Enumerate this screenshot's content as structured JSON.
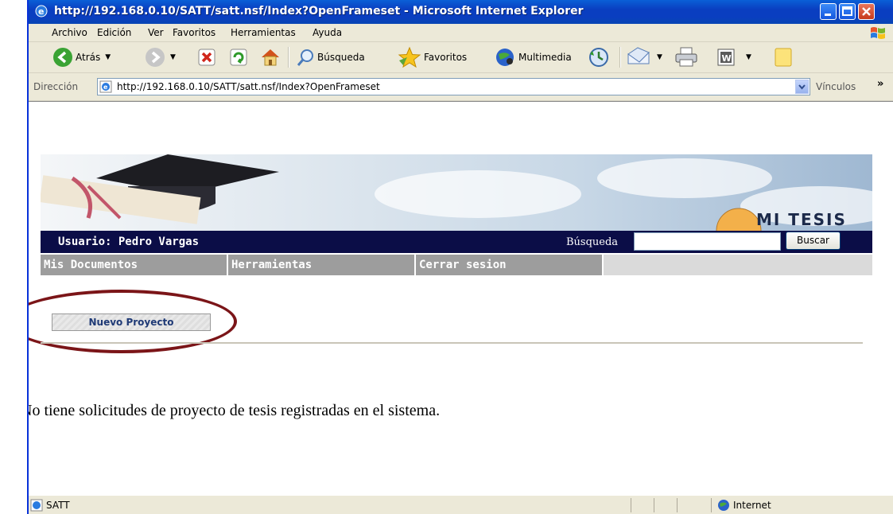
{
  "window": {
    "title": "http://192.168.0.10/SATT/satt.nsf/Index?OpenFrameset - Microsoft Internet Explorer"
  },
  "menu": [
    "Archivo",
    "Edición",
    "Ver",
    "Favoritos",
    "Herramientas",
    "Ayuda"
  ],
  "toolbar": {
    "back_label": "Atrás",
    "search_label": "Búsqueda",
    "favorites_label": "Favoritos",
    "media_label": "Multimedia"
  },
  "address": {
    "label": "Dirección",
    "url": "http://192.168.0.10/SATT/satt.nsf/Index?OpenFrameset",
    "links_label": "Vínculos"
  },
  "page": {
    "banner_title": "MI TESIS",
    "user_label": "Usuario: Pedro Vargas",
    "search_label": "Búsqueda",
    "search_value": "",
    "search_button": "Buscar",
    "nav": [
      "Mis Documentos",
      "Herramientas",
      "Cerrar sesion"
    ],
    "new_project_button": "Nuevo Proyecto",
    "message": "No tiene solicitudes de proyecto de tesis registradas en el sistema."
  },
  "status": {
    "text": "SATT",
    "zone": "Internet"
  },
  "colors": {
    "titlebar": "#0a3ec0",
    "user_bar": "#0b0d47",
    "nav_tab": "#9d9d9d",
    "highlight_oval": "#7b1518"
  }
}
